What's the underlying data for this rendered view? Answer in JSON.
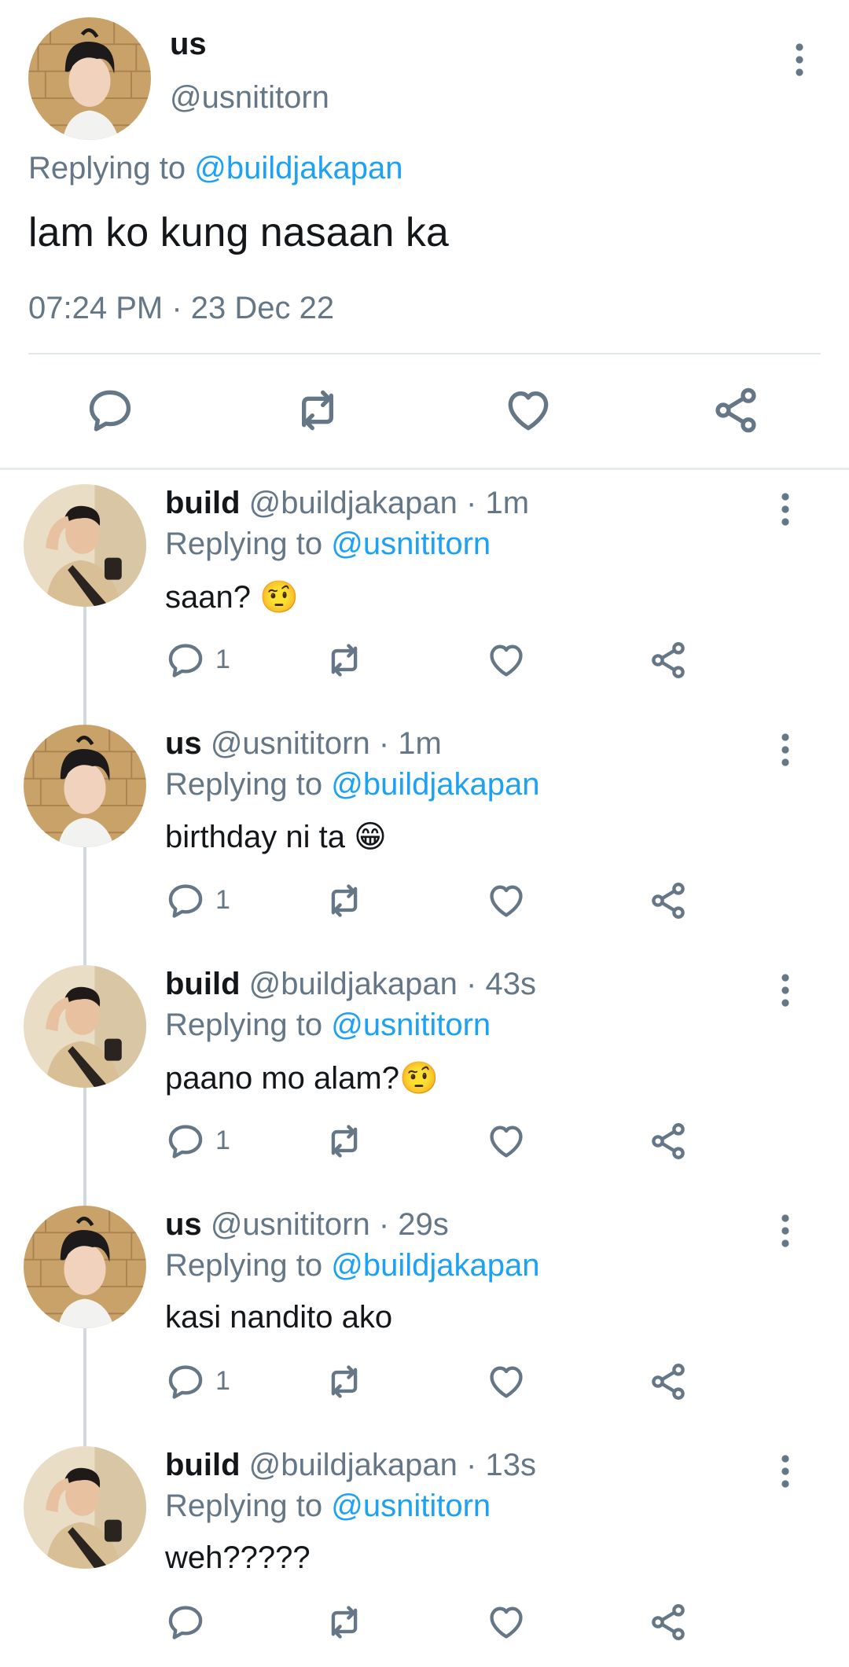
{
  "main_tweet": {
    "name": "us",
    "handle": "@usnititorn",
    "replying_prefix": "Replying to",
    "replying_to": "@buildjakapan",
    "text": "lam ko kung nasaan ka",
    "timestamp": "07:24 PM · 23 Dec 22"
  },
  "replies": [
    {
      "name": "build",
      "handle": "@buildjakapan",
      "time": "· 1m",
      "replying_prefix": "Replying to",
      "replying_to": "@usnititorn",
      "text": "saan?",
      "emoji": "🤨",
      "reply_count": "1"
    },
    {
      "name": "us",
      "handle": "@usnititorn",
      "time": "· 1m",
      "replying_prefix": "Replying to",
      "replying_to": "@buildjakapan",
      "text": "birthday ni ta",
      "emoji": "😁",
      "reply_count": "1"
    },
    {
      "name": "build",
      "handle": "@buildjakapan",
      "time": "· 43s",
      "replying_prefix": "Replying to",
      "replying_to": "@usnititorn",
      "text": "paano mo alam?",
      "emoji": "🤨",
      "reply_count": "1"
    },
    {
      "name": "us",
      "handle": "@usnititorn",
      "time": "· 29s",
      "replying_prefix": "Replying to",
      "replying_to": "@buildjakapan",
      "text": "kasi nandito ako",
      "emoji": "",
      "reply_count": "1"
    },
    {
      "name": "build",
      "handle": "@buildjakapan",
      "time": "· 13s",
      "replying_prefix": "Replying to",
      "replying_to": "@usnititorn",
      "text": "weh?????",
      "emoji": "",
      "reply_count": ""
    }
  ],
  "icons": {
    "reply": "reply-icon",
    "retweet": "retweet-icon",
    "like": "heart-icon",
    "share": "share-icon",
    "more": "more-vertical-icon"
  },
  "colors": {
    "text": "#14171a",
    "secondary": "#657786",
    "link": "#1da1f2",
    "divider": "#e1e8ed",
    "thread_line": "#cfd9de"
  }
}
